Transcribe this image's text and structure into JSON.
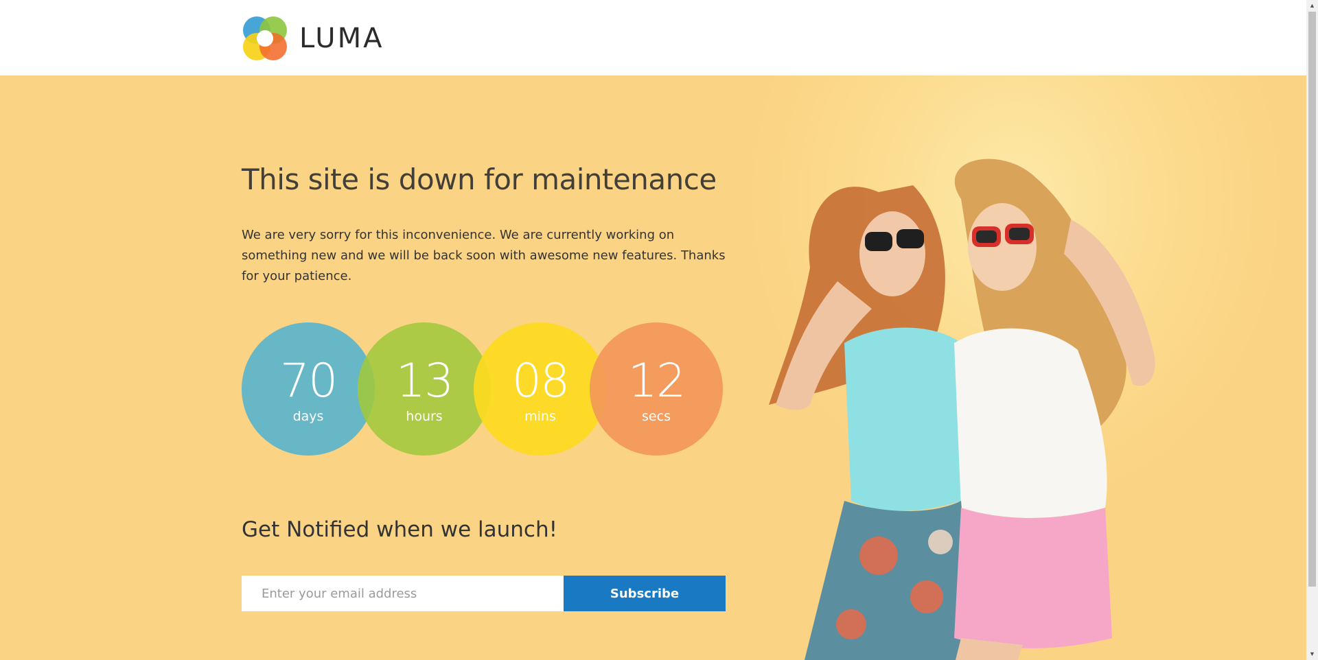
{
  "header": {
    "logo_text": "LUMA",
    "logo_colors": [
      "#f1c40f",
      "#3da0d6",
      "#8cc63e",
      "#f26c2b"
    ]
  },
  "hero": {
    "headline": "This site is down for maintenance",
    "intro": "We are very sorry for this inconvenience. We are currently working on something new and we will be back soon with awesome new features. Thanks for your patience.",
    "background_color": "#fbd384"
  },
  "countdown": {
    "days": {
      "value": "70",
      "label": "days",
      "color": "#5ab4cd"
    },
    "hours": {
      "value": "13",
      "label": "hours",
      "color": "#a0c83c"
    },
    "mins": {
      "value": "08",
      "label": "mins",
      "color": "#fdda1e"
    },
    "secs": {
      "value": "12",
      "label": "secs",
      "color": "#f3965a"
    }
  },
  "notify": {
    "title": "Get Notified when we launch!",
    "email_placeholder": "Enter your email address",
    "email_value": "",
    "subscribe_label": "Subscribe",
    "button_color": "#1979c3"
  },
  "scrollbar": {
    "up_icon": "triangle-up-icon",
    "down_icon": "triangle-down-icon"
  }
}
